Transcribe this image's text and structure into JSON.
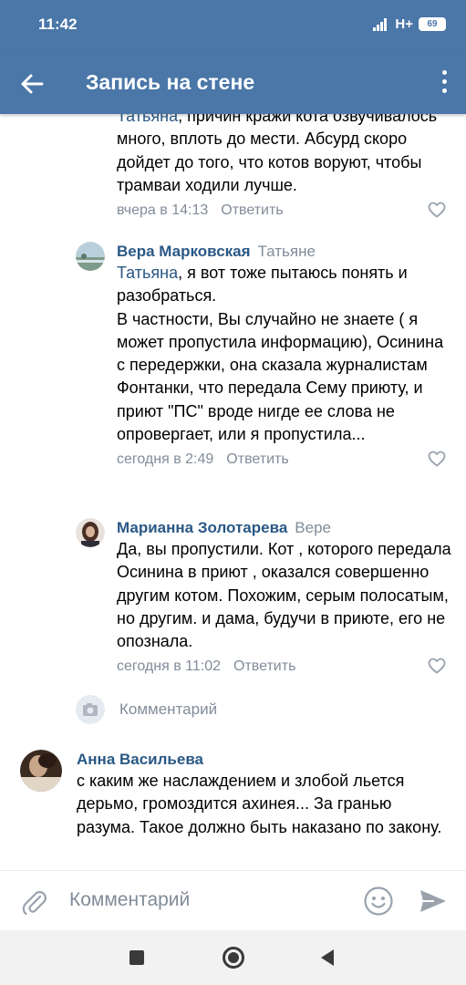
{
  "status_bar": {
    "time": "11:42",
    "network": "H+",
    "battery": "69"
  },
  "app_bar": {
    "title": "Запись на стене"
  },
  "comments": [
    {
      "mention": "Татьяна",
      "text": ", причин кражи кота озвучивалось много, вплоть до мести. Абсурд скоро дойдет до того, что котов воруют, чтобы трамваи ходили лучше.",
      "time": "вчера в 14:13",
      "reply_label": "Ответить"
    },
    {
      "author": "Вера Марковская",
      "reply_to": "Татьяне",
      "mention": "Татьяна",
      "text": ", я вот тоже пытаюсь понять и разобраться.\nВ частности, Вы случайно не знаете ( я может пропустила информацию), Осинина с передержки, она сказала журналистам Фонтанки, что передала Сему приюту, и приют \"ПС\" вроде нигде ее слова не опровергает, или я пропустила...",
      "time": "сегодня в 2:49",
      "reply_label": "Ответить"
    },
    {
      "author": "Марианна Золотарева",
      "reply_to": "Вере",
      "text": "Да, вы пропустили. Кот , которого передала Осинина в приют , оказался совершенно другим котом. Похожим, серым полосатым, но другим. и дама, будучи в приюте, его не опознала.",
      "time": "сегодня в 11:02",
      "reply_label": "Ответить"
    }
  ],
  "reply_field": {
    "placeholder": "Комментарий"
  },
  "top_comment": {
    "author": "Анна Васильева",
    "text": "с каким же наслаждением и злобой льется дерьмо, громоздится ахинея... За гранью разума. Такое должно быть наказано по закону."
  },
  "input": {
    "placeholder": "Комментарий"
  },
  "colors": {
    "header": "#4a76a8",
    "link": "#2a5885",
    "muted": "#818c99"
  }
}
